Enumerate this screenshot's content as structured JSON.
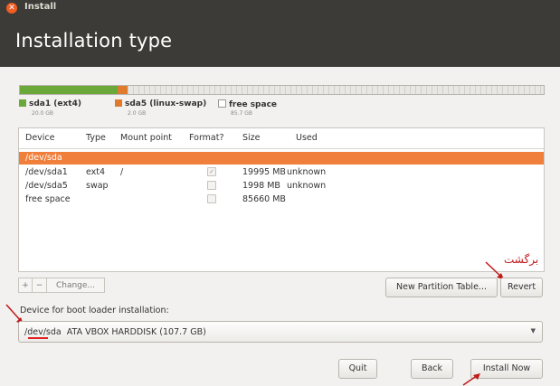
{
  "window": {
    "title": "Install",
    "close_icon": "close-icon"
  },
  "page": {
    "title": "Installation type"
  },
  "disk_usage": {
    "segments": [
      {
        "name": "sda1 (ext4)",
        "size": "20.0 GB",
        "color": "#6aa839",
        "fraction": 0.186
      },
      {
        "name": "sda5 (linux-swap)",
        "size": "2.0 GB",
        "color": "#e07b2e",
        "fraction": 0.019
      },
      {
        "name": "free space",
        "size": "85.7 GB",
        "color": "#ffffff",
        "fraction": 0.795
      }
    ]
  },
  "table": {
    "headers": [
      "Device",
      "Type",
      "Mount point",
      "Format?",
      "Size",
      "Used"
    ],
    "rows": [
      {
        "device": "/dev/sda",
        "type": "",
        "mount": "",
        "format": "",
        "size": "",
        "used": "",
        "selected": true
      },
      {
        "device": "/dev/sda1",
        "type": "ext4",
        "mount": "/",
        "format": "✓",
        "size": "19995 MB",
        "used": "unknown"
      },
      {
        "device": "/dev/sda5",
        "type": "swap",
        "mount": "",
        "format": "",
        "size": "1998 MB",
        "used": "unknown"
      },
      {
        "device": "free space",
        "type": "",
        "mount": "",
        "format": "",
        "size": "85660 MB",
        "used": ""
      }
    ]
  },
  "partition_controls": {
    "add_label": "+",
    "remove_label": "−",
    "change_label": "Change...",
    "new_table_label": "New Partition Table...",
    "revert_label": "Revert"
  },
  "boot_loader": {
    "label": "Device for boot loader installation:",
    "selected_device": "/dev/sda",
    "selected_desc": "ATA VBOX HARDDISK (107.7 GB)"
  },
  "buttons": {
    "quit": "Quit",
    "back": "Back",
    "install_now": "Install Now"
  },
  "annotation": {
    "persian_text": "برگشت",
    "color": "#c0181a"
  }
}
